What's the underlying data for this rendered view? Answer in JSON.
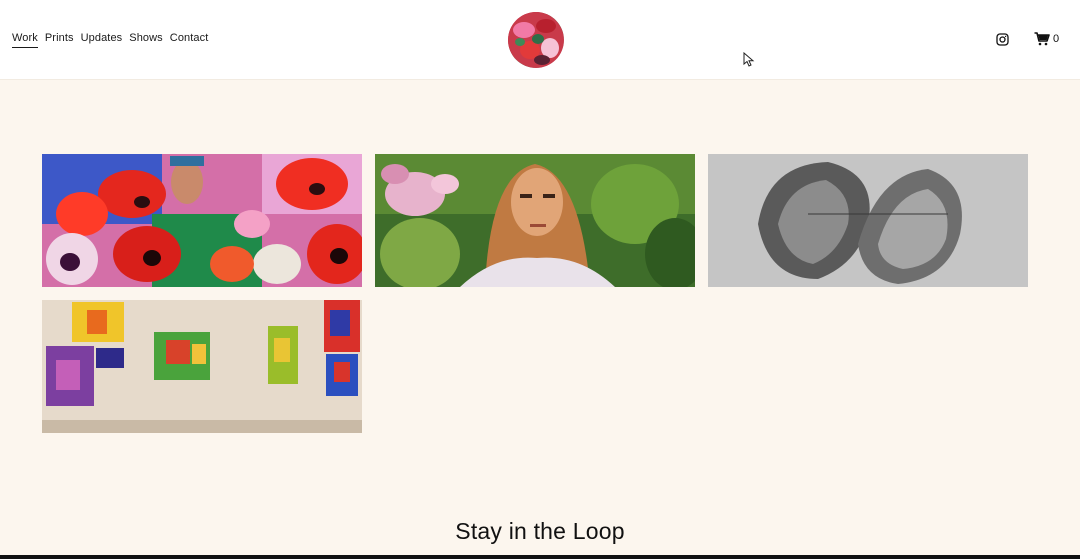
{
  "nav": {
    "items": [
      "Work",
      "Prints",
      "Updates",
      "Shows",
      "Contact"
    ],
    "active": "Work"
  },
  "header": {
    "logo_icon": "artist-logo-icon",
    "social_icon": "instagram-icon",
    "cart_icon": "cart-icon",
    "cart_count": "0"
  },
  "gallery": {
    "tiles": [
      {
        "icon": "poppies-painting-image"
      },
      {
        "icon": "portrait-painting-image"
      },
      {
        "icon": "charcoal-drawing-image"
      },
      {
        "icon": "exhibition-wall-image"
      }
    ]
  },
  "footer": {
    "heading": "Stay in the Loop"
  },
  "colors": {
    "page_bg": "#fcf6ee",
    "header_bg": "#ffffff",
    "text": "#111111"
  }
}
